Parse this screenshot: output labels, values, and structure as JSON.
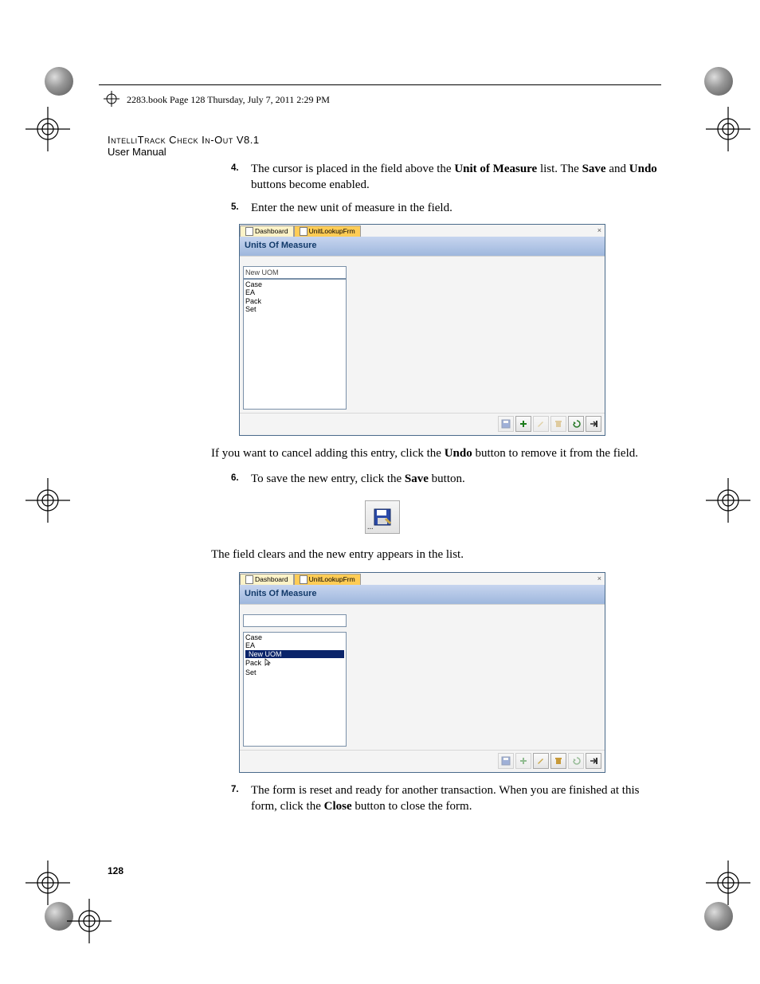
{
  "cropmark_text": "2283.book  Page 128  Thursday, July 7, 2011  2:29 PM",
  "header": {
    "product_line": "IntelliTrack Check In-Out V8.1",
    "subtitle": "User Manual"
  },
  "steps": {
    "s4": {
      "num": "4.",
      "pre": "The cursor is placed in the field above the ",
      "bold1": "Unit of Measure",
      "mid1": " list. The ",
      "bold2": "Save",
      "mid2": " and ",
      "bold3": "Undo",
      "post": " buttons become enabled."
    },
    "s5": {
      "num": "5.",
      "text": "Enter the new unit of measure in the field."
    },
    "undo_para": {
      "pre": "If you want to cancel adding this entry, click the ",
      "bold": "Undo",
      "post": " button to remove it from the field."
    },
    "s6": {
      "num": "6.",
      "pre": "To save the new entry, click the ",
      "bold": "Save",
      "post": " button."
    },
    "clears_para": "The field clears and the new entry appears in the list.",
    "s7": {
      "num": "7.",
      "pre": "The form is reset and ready for another transaction. When you are finished at this form, click the ",
      "bold": "Close",
      "post": " button to close the form."
    }
  },
  "screenshot1": {
    "tab1": "Dashboard",
    "tab2": "UnitLookupFrm",
    "close_x": "×",
    "title": "Units Of Measure",
    "input_value": "New UOM",
    "items": [
      "Case",
      "EA",
      "Pack",
      "Set"
    ]
  },
  "screenshot2": {
    "tab1": "Dashboard",
    "tab2": "UnitLookupFrm",
    "close_x": "×",
    "title": "Units Of Measure",
    "input_value": "",
    "items": [
      "Case",
      "EA",
      "New UOM",
      "Pack",
      "Set"
    ],
    "selected": "New UOM"
  },
  "save_icon_label": "...",
  "page_number": "128"
}
